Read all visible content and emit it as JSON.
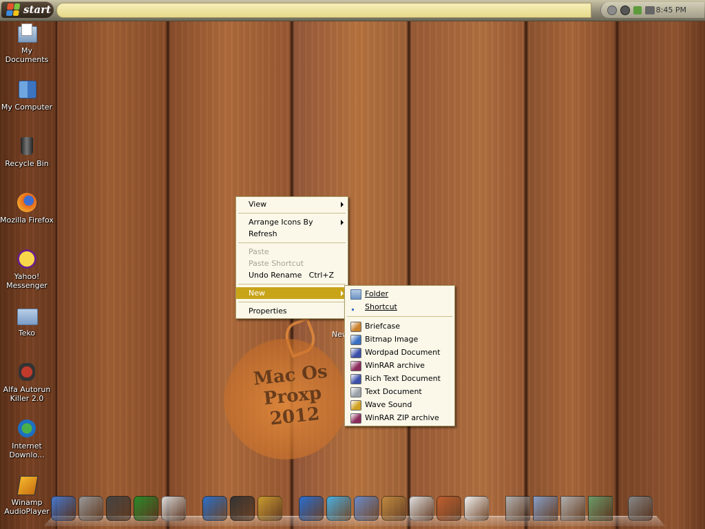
{
  "taskbar": {
    "start_label": "start",
    "clock": "8:45 PM",
    "tray_icons": [
      "volume-icon",
      "network-icon",
      "messenger-icon",
      "keyboard-icon"
    ]
  },
  "desktop_icons": [
    {
      "label": "My Documents",
      "icon": "folder-icon"
    },
    {
      "label": "My Computer",
      "icon": "computer-icon"
    },
    {
      "label": "Recycle Bin",
      "icon": "trash-icon"
    },
    {
      "label": "Mozilla Firefox",
      "icon": "firefox-icon"
    },
    {
      "label": "Yahoo! Messenger",
      "icon": "yahoo-icon"
    },
    {
      "label": "Teko",
      "icon": "folder-icon"
    },
    {
      "label": "Alfa Autorun Killer 2.0",
      "icon": "virus-icon"
    },
    {
      "label": "Internet Downlo...",
      "icon": "download-icon"
    },
    {
      "label": "Winamp AudioPlayer",
      "icon": "winamp-icon"
    }
  ],
  "partial_icon_label": "New Doc",
  "wallpaper_text": {
    "line1": "Mac Os",
    "line2": "Proxp",
    "line3": "2012"
  },
  "context_menu": {
    "view": "View",
    "arrange": "Arrange Icons By",
    "refresh": "Refresh",
    "paste": "Paste",
    "paste_shortcut": "Paste Shortcut",
    "undo_rename": "Undo Rename",
    "undo_shortcut": "Ctrl+Z",
    "new": "New",
    "properties": "Properties"
  },
  "new_submenu": {
    "folder": "Folder",
    "shortcut": "Shortcut",
    "items": [
      {
        "label": "Briefcase",
        "icon": "briefcase-icon",
        "color": "#c9802a"
      },
      {
        "label": "Bitmap Image",
        "icon": "bitmap-icon",
        "color": "#3a6fc0"
      },
      {
        "label": "Wordpad Document",
        "icon": "wordpad-icon",
        "color": "#3b4fa8"
      },
      {
        "label": "WinRAR archive",
        "icon": "winrar-icon",
        "color": "#8a2a5a"
      },
      {
        "label": "Rich Text Document",
        "icon": "richtext-icon",
        "color": "#3b4fa8"
      },
      {
        "label": "Text Document",
        "icon": "text-document-icon",
        "color": "#9aa0a8"
      },
      {
        "label": "Wave Sound",
        "icon": "wave-sound-icon",
        "color": "#d0a020"
      },
      {
        "label": "WinRAR ZIP archive",
        "icon": "winrar-zip-icon",
        "color": "#8a2a5a"
      }
    ]
  },
  "dock": [
    "finder-icon",
    "system-preferences-icon",
    "power-icon",
    "activity-monitor-icon",
    "drive-icon",
    "media-player-icon",
    "film-icon",
    "winamp-icon",
    "internet-explorer-icon",
    "messenger-icon",
    "mail-icon",
    "address-book-icon",
    "calculator-icon",
    "instruments-icon",
    "text-edit-icon",
    "stack-icon",
    "applications-stack-icon",
    "stack-icon",
    "downloads-stack-icon",
    "trash-icon"
  ]
}
